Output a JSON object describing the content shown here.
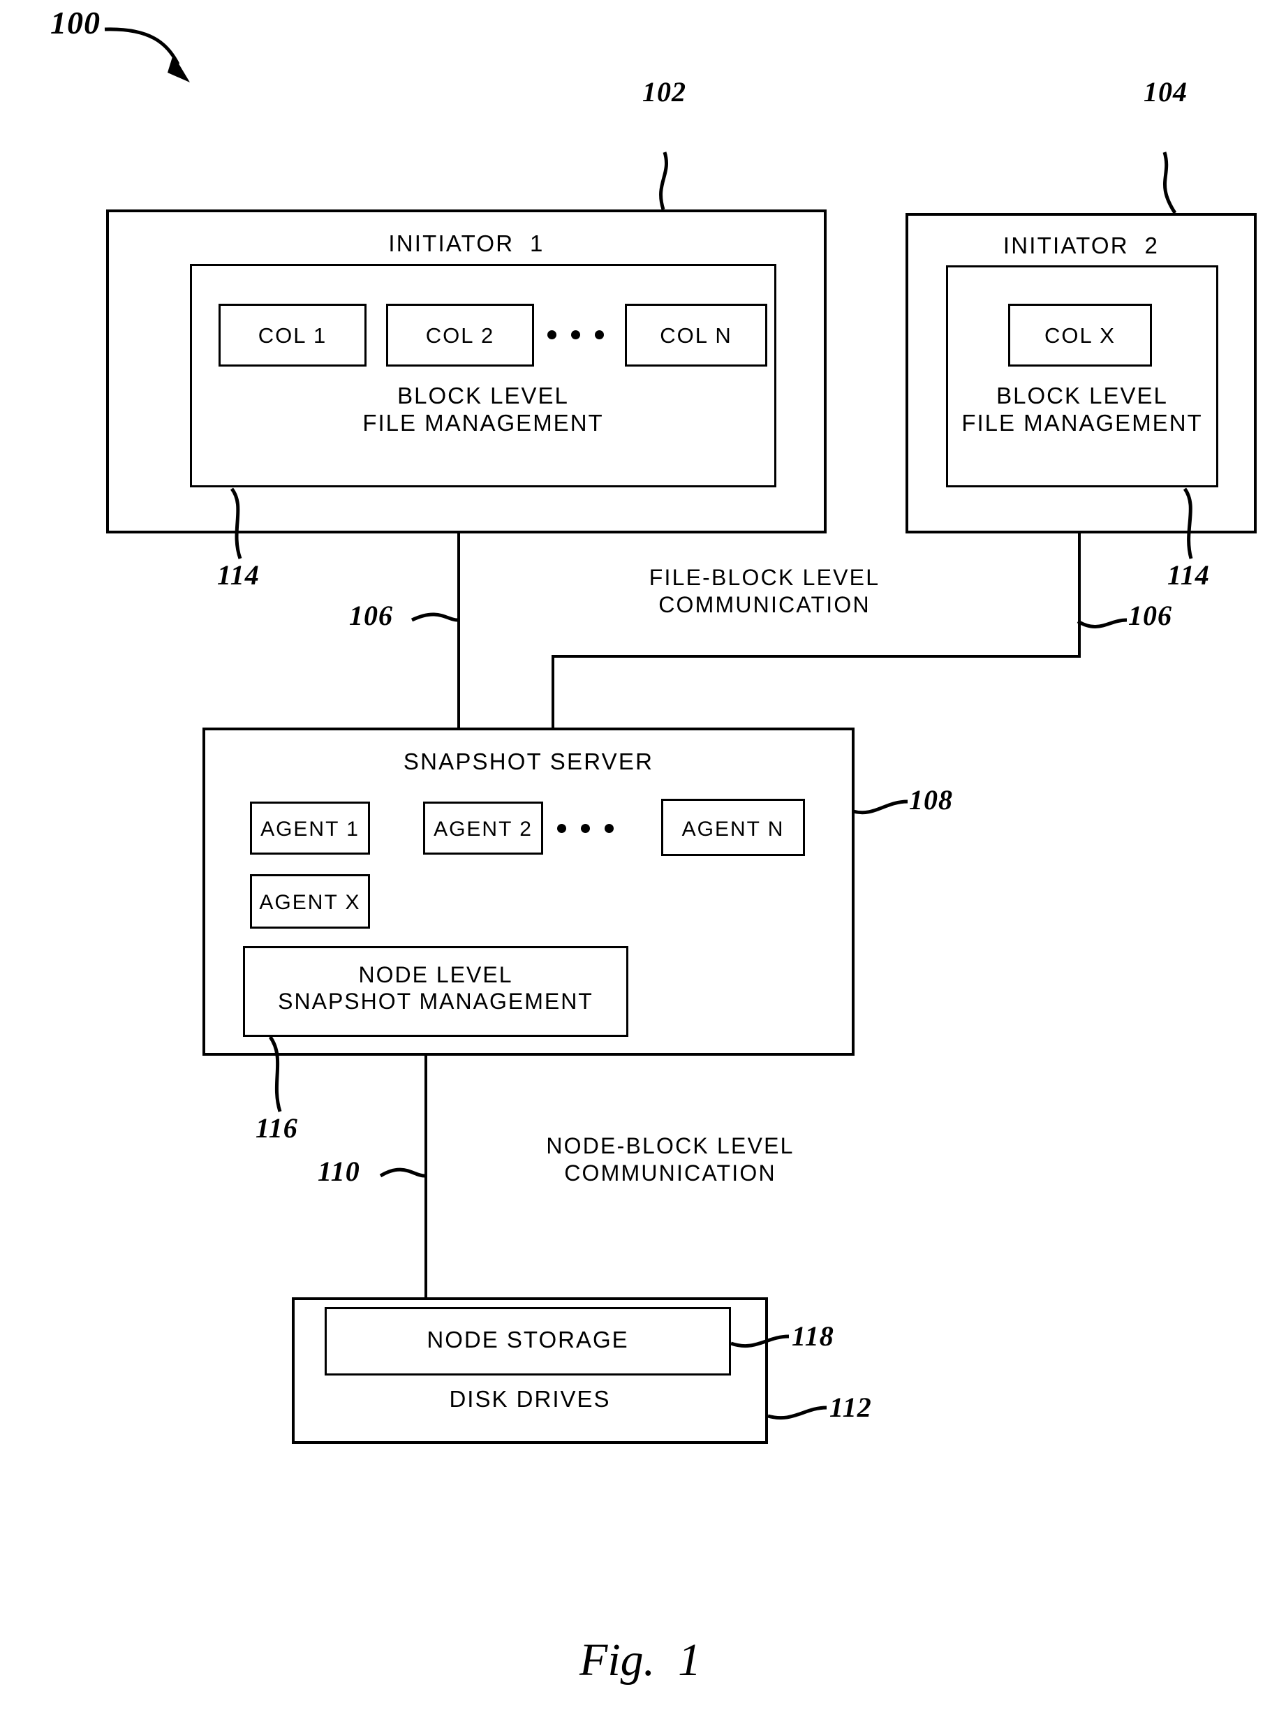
{
  "figure": {
    "number": "100",
    "caption": "Fig.  1"
  },
  "initiator1": {
    "ref": "102",
    "title": "INITIATOR  1",
    "inner_ref": "114",
    "inner_title": "BLOCK LEVEL\nFILE MANAGEMENT",
    "columns": [
      {
        "label": "COL 1"
      },
      {
        "label": "COL 2"
      },
      {
        "label": "COL N"
      }
    ]
  },
  "initiator2": {
    "ref": "104",
    "title": "INITIATOR  2",
    "inner_ref": "114",
    "inner_title": "BLOCK LEVEL\nFILE MANAGEMENT",
    "columns": [
      {
        "label": "COL X"
      }
    ]
  },
  "links": {
    "file_block": {
      "ref_left": "106",
      "ref_right": "106",
      "caption": "FILE-BLOCK LEVEL\nCOMMUNICATION"
    },
    "node_block": {
      "ref": "110",
      "caption": "NODE-BLOCK LEVEL\nCOMMUNICATION"
    }
  },
  "snapshot_server": {
    "ref": "108",
    "title": "SNAPSHOT SERVER",
    "agents": [
      {
        "label": "AGENT 1"
      },
      {
        "label": "AGENT 2"
      },
      {
        "label": "AGENT N"
      },
      {
        "label": "AGENT X"
      }
    ],
    "management": {
      "ref": "116",
      "title": "NODE LEVEL\nSNAPSHOT MANAGEMENT"
    }
  },
  "storage": {
    "ref": "112",
    "title": "DISK DRIVES",
    "node_storage": {
      "ref": "118",
      "title": "NODE STORAGE"
    }
  }
}
